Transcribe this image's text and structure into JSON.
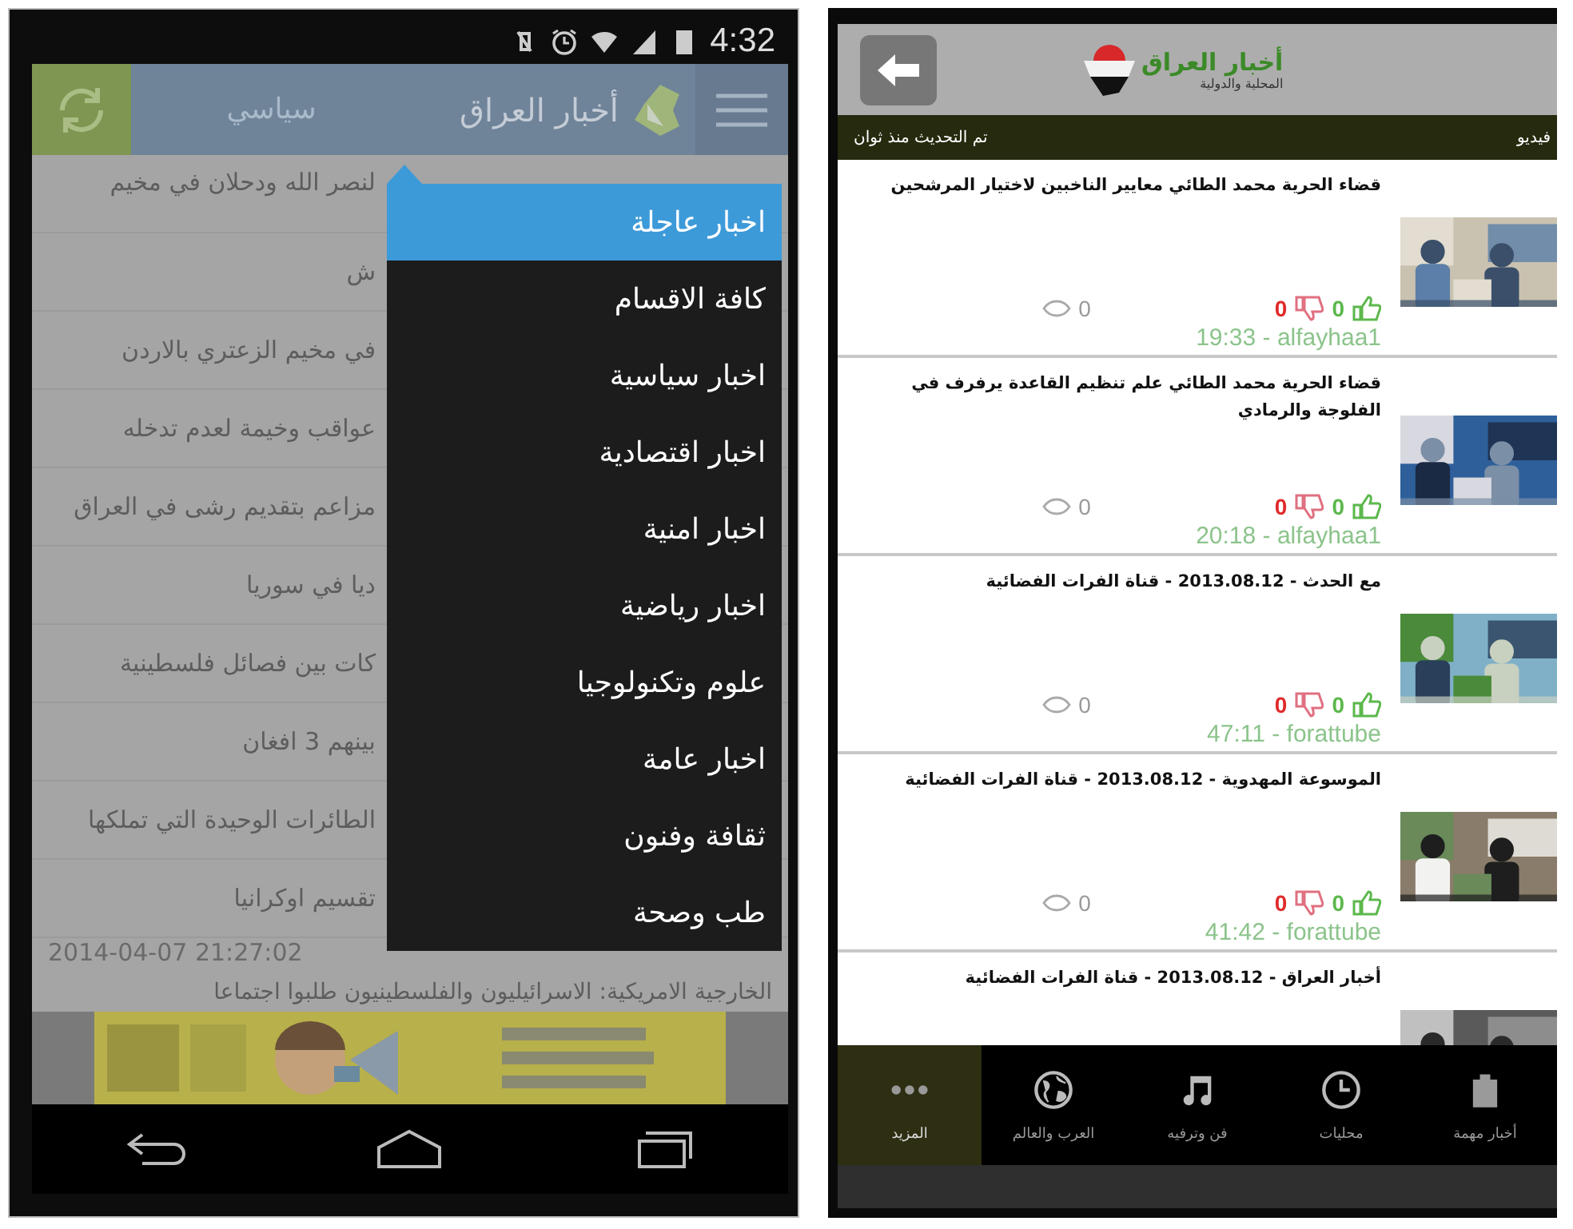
{
  "left_screen": {
    "status_bar": {
      "time": "4:32"
    },
    "app_bar": {
      "title": "أخبار العراق",
      "section": "سياسي"
    },
    "news_list": [
      {
        "text": "لنصر الله ودحلان في مخيم"
      },
      {
        "text": "ش"
      },
      {
        "text": "في مخيم الزعتري بالاردن"
      },
      {
        "text": "عواقب وخيمة لعدم تدخله"
      },
      {
        "text": "مزاعم بتقديم رشى في العراق"
      },
      {
        "text": "ديا في سوريا"
      },
      {
        "text": "كات بين فصائل فلسطينية"
      },
      {
        "text": "بينهم 3 افغان"
      },
      {
        "text": "الطائرات الوحيدة التي تملكها"
      },
      {
        "text": "تقسيم اوكرانيا"
      }
    ],
    "timestamp": "2014-04-07 21:27:02",
    "last_item": "الخارجية الامريكية: الاسرائيليون والفلسطينيون طلبوا اجتماعا",
    "menu": [
      {
        "label": "اخبار عاجلة",
        "selected": true
      },
      {
        "label": "كافة الاقسام",
        "selected": false
      },
      {
        "label": "اخبار سياسية",
        "selected": false
      },
      {
        "label": "اخبار اقتصادية",
        "selected": false
      },
      {
        "label": "اخبار امنية",
        "selected": false
      },
      {
        "label": "اخبار رياضية",
        "selected": false
      },
      {
        "label": "علوم وتكنولوجيا",
        "selected": false
      },
      {
        "label": "اخبار عامة",
        "selected": false
      },
      {
        "label": "ثقافة وفنون",
        "selected": false
      },
      {
        "label": "طب وصحة",
        "selected": false
      }
    ]
  },
  "right_screen": {
    "app_bar": {
      "logo_title": "أخبار العراق",
      "logo_subtitle": "المحلية والدولية"
    },
    "info_bar": {
      "section": "فيديو",
      "updated": "تم التحديث منذ ثوان"
    },
    "videos": [
      {
        "title": "قضاء الحرية محمد الطائي معايير الناخبين لاختيار المرشحين",
        "views": "0",
        "dislikes": "0",
        "likes": "0",
        "meta": "19:33 - alfayhaa1"
      },
      {
        "title": "قضاء الحرية محمد الطائي علم تنظيم القاعدة يرفرف في الفلوجة والرمادي",
        "views": "0",
        "dislikes": "0",
        "likes": "0",
        "meta": "20:18 - alfayhaa1"
      },
      {
        "title": "مع الحدث - 2013.08.12 - قناة الفرات الفضائية",
        "views": "0",
        "dislikes": "0",
        "likes": "0",
        "meta": "47:11 - forattube"
      },
      {
        "title": "الموسوعة المهدوية - 2013.08.12 - قناة الفرات الفضائية",
        "views": "0",
        "dislikes": "0",
        "likes": "0",
        "meta": "41:42 - forattube"
      },
      {
        "title": "أخبار العراق - 2013.08.12 - قناة الفرات الفضائية"
      }
    ],
    "tabs": [
      {
        "label": "أخبار مهمة",
        "selected": false
      },
      {
        "label": "محليات",
        "selected": false
      },
      {
        "label": "فن وترفيه",
        "selected": false
      },
      {
        "label": "العرب والعالم",
        "selected": false
      },
      {
        "label": "المزيد",
        "selected": true
      }
    ]
  }
}
